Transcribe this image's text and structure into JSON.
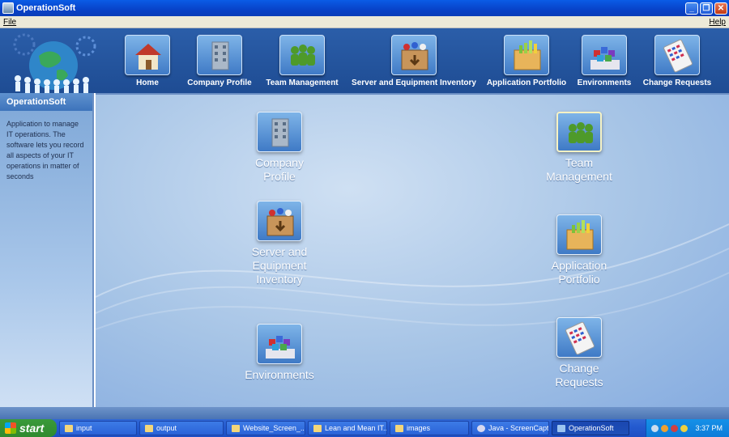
{
  "window": {
    "title": "OperationSoft"
  },
  "menu": {
    "file": "File",
    "help": "Help"
  },
  "nav": [
    {
      "label": "Home",
      "icon": "house-icon"
    },
    {
      "label": "Company Profile",
      "icon": "building-icon"
    },
    {
      "label": "Team Management",
      "icon": "team-icon"
    },
    {
      "label": "Server and Equipment Inventory",
      "icon": "box-icon"
    },
    {
      "label": "Application Portfolio",
      "icon": "folder-chart-icon"
    },
    {
      "label": "Environments",
      "icon": "cubes-icon"
    },
    {
      "label": "Change Requests",
      "icon": "calculator-icon"
    }
  ],
  "sidebar": {
    "title": "OperationSoft",
    "description": "Application to manage IT operations.  The software lets you record all aspects of your IT operations in matter of seconds"
  },
  "main": {
    "items": [
      {
        "label": "Company Profile",
        "icon": "building-icon"
      },
      {
        "label": "Team Management",
        "icon": "team-icon"
      },
      {
        "label": "Server and Equipment Inventory",
        "icon": "box-icon"
      },
      {
        "label": "Application Portfolio",
        "icon": "folder-chart-icon"
      },
      {
        "label": "Environments",
        "icon": "cubes-icon"
      },
      {
        "label": "Change Requests",
        "icon": "calculator-icon"
      }
    ]
  },
  "taskbar": {
    "start": "start",
    "tasks": [
      "input",
      "output",
      "Website_Screen_...",
      "Lean and Mean IT...",
      "images",
      "Java - ScreenCapt...",
      "OperationSoft"
    ],
    "clock": "3:37 PM"
  }
}
